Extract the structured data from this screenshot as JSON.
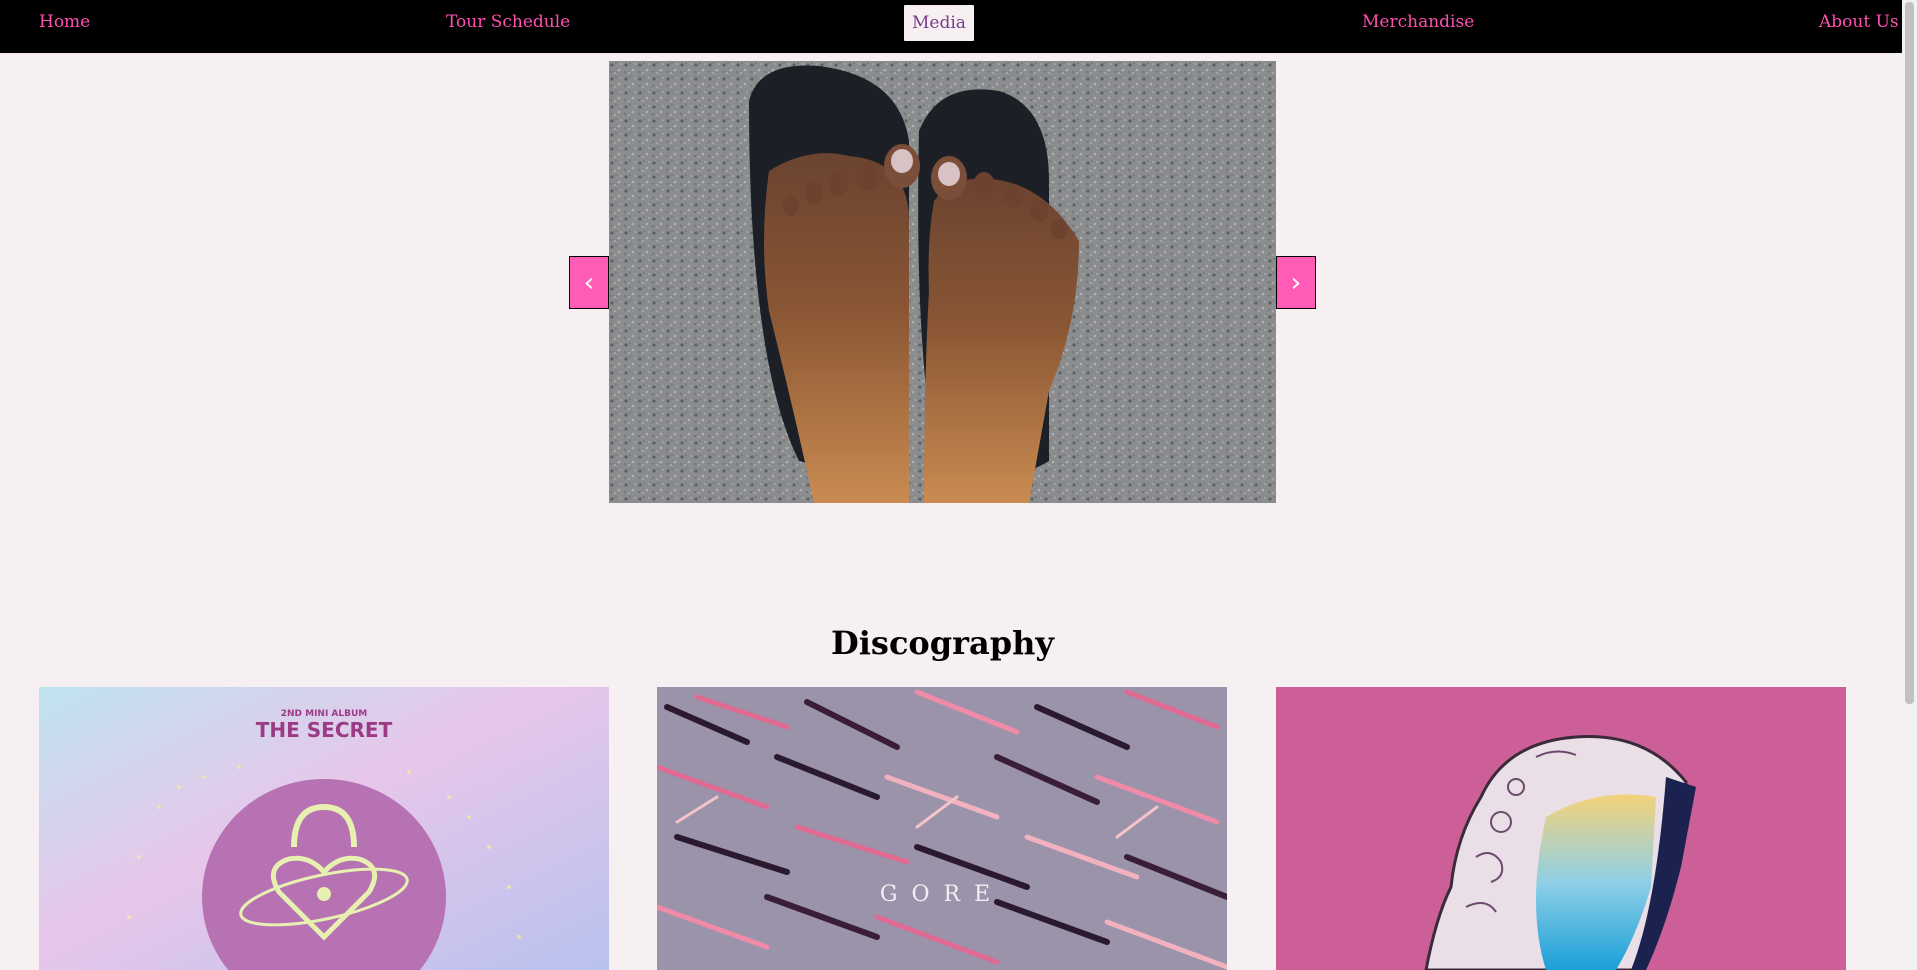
{
  "nav": {
    "items": [
      {
        "label": "Home"
      },
      {
        "label": "Tour Schedule"
      },
      {
        "label": "Media",
        "active": true
      },
      {
        "label": "Merchandise"
      },
      {
        "label": "About Us"
      }
    ]
  },
  "carousel": {
    "prev_label": "‹",
    "next_label": "›",
    "image_icon": "feet-on-asphalt-photo"
  },
  "discography": {
    "title": "Discography",
    "albums": [
      {
        "cover_text_small": "2ND MINI ALBUM",
        "cover_text_title": "THE SECRET"
      },
      {
        "cover_text_title": "GORE"
      },
      {
        "cover_text_title": ""
      }
    ]
  },
  "colors": {
    "accent": "#ff4fb1",
    "nav_bg": "#000000",
    "page_bg": "#f6f0f3"
  }
}
